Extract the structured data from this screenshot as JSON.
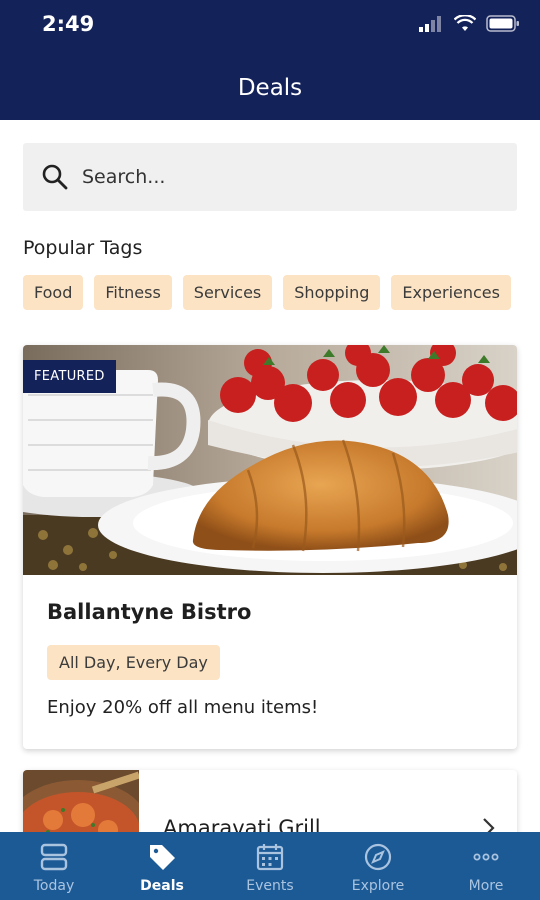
{
  "status_bar": {
    "time": "2:49"
  },
  "header": {
    "title": "Deals"
  },
  "search": {
    "placeholder": "Search..."
  },
  "popular_tags": {
    "label": "Popular Tags",
    "tags": [
      "Food",
      "Fitness",
      "Services",
      "Shopping",
      "Experiences"
    ]
  },
  "deals": [
    {
      "badge": "FEATURED",
      "title": "Ballantyne Bistro",
      "availability": "All Day, Every Day",
      "description": "Enjoy 20% off all menu items!"
    },
    {
      "title": "Amaravati Grill"
    }
  ],
  "tab_bar": {
    "tabs": [
      {
        "label": "Today",
        "icon": "today-icon",
        "active": false
      },
      {
        "label": "Deals",
        "icon": "tag-icon",
        "active": true
      },
      {
        "label": "Events",
        "icon": "calendar-icon",
        "active": false
      },
      {
        "label": "Explore",
        "icon": "compass-icon",
        "active": false
      },
      {
        "label": "More",
        "icon": "more-dots-icon",
        "active": false
      }
    ]
  },
  "colors": {
    "header_bg": "#14225a",
    "tab_bar_bg": "#1c5a96",
    "tag_bg": "#fbe3c4",
    "search_bg": "#f0f0f0"
  }
}
